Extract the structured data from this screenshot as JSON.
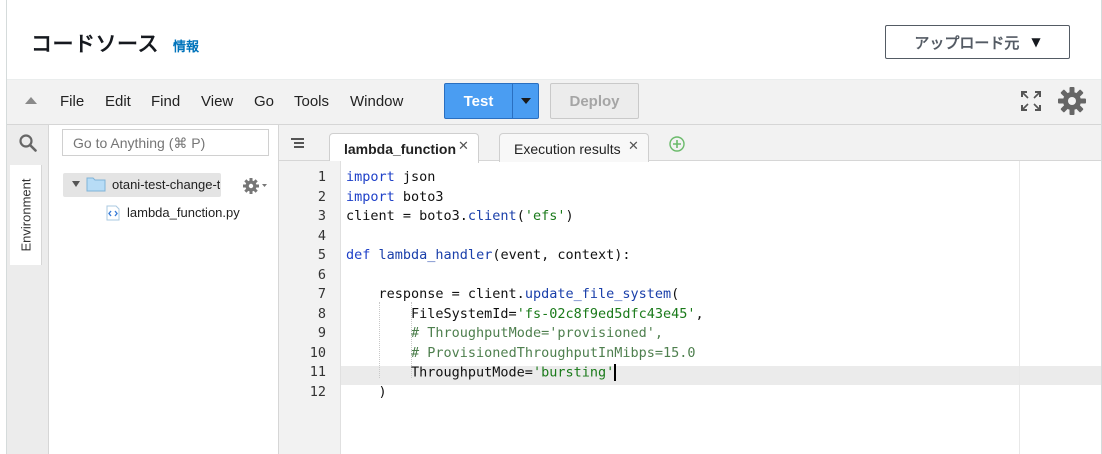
{
  "header": {
    "title": "コードソース",
    "info_link": "情報",
    "upload_button": "アップロード元",
    "upload_caret": "▼"
  },
  "menubar": {
    "items": [
      "File",
      "Edit",
      "Find",
      "View",
      "Go",
      "Tools",
      "Window"
    ],
    "test_label": "Test",
    "deploy_label": "Deploy"
  },
  "sidebar": {
    "environment_tab": "Environment",
    "goto_placeholder": "Go to Anything (⌘ P)",
    "folder_name": "otani-test-change-t",
    "file_name": "lambda_function.py"
  },
  "tabs": [
    {
      "label": "lambda_function",
      "active": true
    },
    {
      "label": "Execution results",
      "active": false
    }
  ],
  "editor": {
    "line_numbers": [
      "1",
      "2",
      "3",
      "4",
      "5",
      "6",
      "7",
      "8",
      "9",
      "10",
      "11",
      "12"
    ],
    "active_line": 11,
    "lines": [
      [
        {
          "t": "import",
          "c": "kw"
        },
        {
          "t": " json",
          "c": ""
        }
      ],
      [
        {
          "t": "import",
          "c": "kw"
        },
        {
          "t": " boto3",
          "c": ""
        }
      ],
      [
        {
          "t": "client = boto3.",
          "c": ""
        },
        {
          "t": "client",
          "c": "fn"
        },
        {
          "t": "(",
          "c": ""
        },
        {
          "t": "'efs'",
          "c": "str"
        },
        {
          "t": ")",
          "c": ""
        }
      ],
      [],
      [
        {
          "t": "def",
          "c": "kw"
        },
        {
          "t": " ",
          "c": ""
        },
        {
          "t": "lambda_handler",
          "c": "fn"
        },
        {
          "t": "(event, context):",
          "c": ""
        }
      ],
      [],
      [
        {
          "t": "    response = client.",
          "c": ""
        },
        {
          "t": "update_file_system",
          "c": "fn"
        },
        {
          "t": "(",
          "c": ""
        }
      ],
      [
        {
          "t": "        FileSystemId=",
          "c": ""
        },
        {
          "t": "'fs-02c8f9ed5dfc43e45'",
          "c": "str"
        },
        {
          "t": ",",
          "c": ""
        }
      ],
      [
        {
          "t": "        ",
          "c": ""
        },
        {
          "t": "# ThroughputMode='provisioned',",
          "c": "cm"
        }
      ],
      [
        {
          "t": "        ",
          "c": ""
        },
        {
          "t": "# ProvisionedThroughputInMibps=15.0",
          "c": "cm"
        }
      ],
      [
        {
          "t": "        ThroughputMode=",
          "c": ""
        },
        {
          "t": "'bursting'",
          "c": "str"
        }
      ],
      [
        {
          "t": "    )",
          "c": ""
        }
      ]
    ]
  }
}
